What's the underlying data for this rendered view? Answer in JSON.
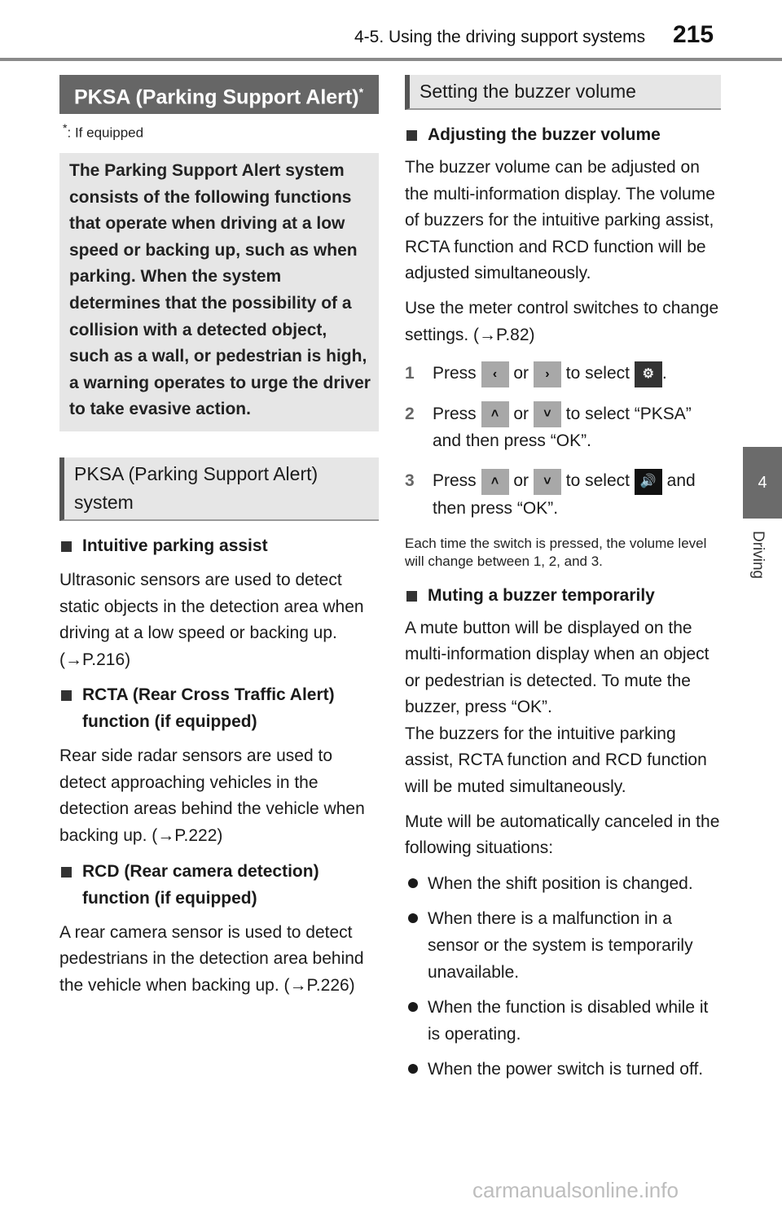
{
  "header": {
    "section_title": "4-5. Using the driving support systems",
    "page_number": "215"
  },
  "side_tab": {
    "chapter_number": "4",
    "chapter_label": "Driving"
  },
  "left": {
    "title_main": "PKSA (Parking Support Alert)",
    "title_mark": "*",
    "footnote_mark": "*",
    "footnote_text": ": If equipped",
    "intro": "The Parking Support Alert system consists of the following functions that operate when driving at a low speed or backing up, such as when parking. When the system determines that the possibility of a collision with a detected object, such as a wall, or pedestrian is high, a warning operates to urge the driver to take evasive action.",
    "system_heading": "PKSA (Parking Support Alert) system",
    "items": [
      {
        "title": "Intuitive parking assist",
        "body": "Ultrasonic sensors are used to detect static objects in the detection area when driving at a low speed or backing up. (→P.216)"
      },
      {
        "title": "RCTA (Rear Cross Traffic Alert) function (if equipped)",
        "body": "Rear side radar sensors are used to detect approaching vehicles in the detection areas behind the vehicle when backing up. (→P.222)"
      },
      {
        "title": "RCD (Rear camera detection) function (if equipped)",
        "body": "A rear camera sensor is used to detect pedestrians in the detection area behind the vehicle when backing up. (→P.226)"
      }
    ]
  },
  "right": {
    "heading": "Setting the buzzer volume",
    "adjust_title": "Adjusting the buzzer volume",
    "adjust_body": "The buzzer volume can be adjusted on the multi-information display. The volume of buzzers for the intuitive parking assist, RCTA function and RCD function will be adjusted simultaneously.",
    "meter_text": "Use the meter control switches to change settings. (→P.82)",
    "steps": [
      {
        "num": "1",
        "press": "Press",
        "or": "or",
        "select": "to select",
        "end": ".",
        "key1": "‹",
        "key2": "›",
        "target": "⚙"
      },
      {
        "num": "2",
        "press": "Press",
        "or": "or",
        "select": "to select “PKSA” and then press “OK”.",
        "key1": "˄",
        "key2": "˅"
      },
      {
        "num": "3",
        "press": "Press",
        "or": "or",
        "select": "to select",
        "end": "and then press “OK”.",
        "key1": "˄",
        "key2": "˅",
        "target": "🔊"
      }
    ],
    "step_note": "Each time the switch is pressed, the volume level will change between 1, 2, and 3.",
    "mute_title": "Muting a buzzer temporarily",
    "mute_body1": "A mute button will be displayed on the multi-information display when an object or pedestrian is detected. To mute the buzzer, press “OK”.",
    "mute_body2": "The buzzers for the intuitive parking assist, RCTA function and RCD function will be muted simultaneously.",
    "cancel_text": "Mute will be automatically canceled in the following situations:",
    "bullets": [
      "When the shift position is changed.",
      "When there is a malfunction in a sensor or the system is temporarily unavailable.",
      "When the function is disabled while it is operating.",
      "When the power switch is turned off."
    ]
  },
  "watermark": "carmanualsonline.info"
}
